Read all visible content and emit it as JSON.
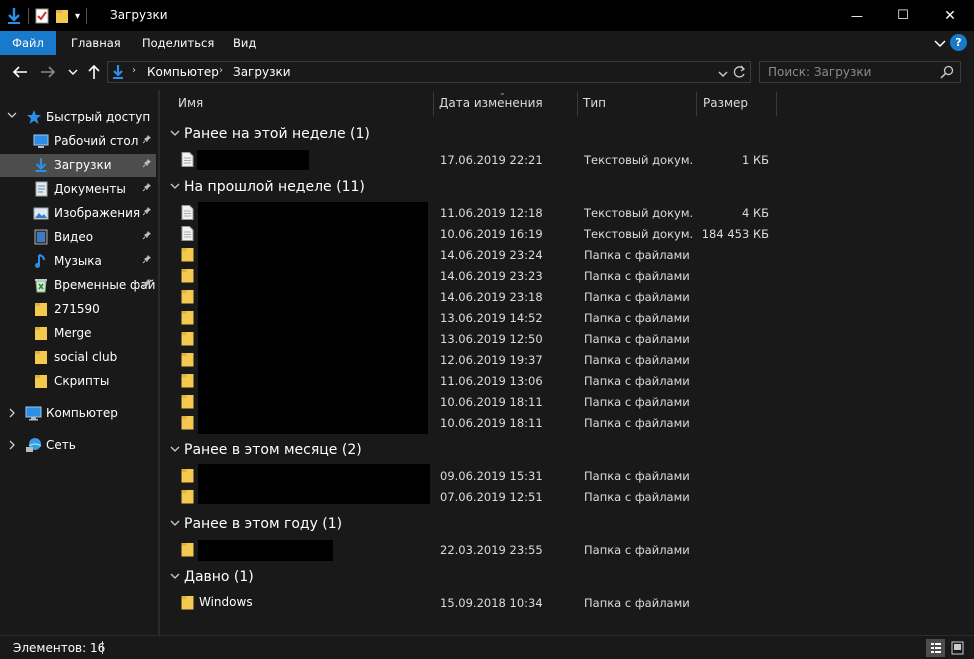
{
  "window": {
    "title": "Загрузки",
    "minimize_glyph": "—",
    "maximize_glyph": "☐",
    "close_glyph": "✕"
  },
  "ribbon": {
    "tabs": [
      "Файл",
      "Главная",
      "Поделиться",
      "Вид"
    ],
    "help_glyph": "?"
  },
  "address": {
    "crumbs": [
      "Компьютер",
      "Загрузки"
    ],
    "search_placeholder": "Поиск: Загрузки"
  },
  "sidebar": {
    "quick_access": "Быстрый доступ",
    "items": [
      {
        "label": "Рабочий стол",
        "icon": "desktop-icon",
        "pinned": true
      },
      {
        "label": "Загрузки",
        "icon": "download-icon",
        "pinned": true,
        "active": true
      },
      {
        "label": "Документы",
        "icon": "documents-icon",
        "pinned": true
      },
      {
        "label": "Изображения",
        "icon": "pictures-icon",
        "pinned": true
      },
      {
        "label": "Видео",
        "icon": "video-icon",
        "pinned": true
      },
      {
        "label": "Музыка",
        "icon": "music-icon",
        "pinned": true
      },
      {
        "label": "Временные фай",
        "icon": "recycle-icon",
        "pinned": true
      },
      {
        "label": "271590",
        "icon": "folder-icon",
        "pinned": false
      },
      {
        "label": "Merge",
        "icon": "folder-icon",
        "pinned": false
      },
      {
        "label": "social club",
        "icon": "folder-icon",
        "pinned": false
      },
      {
        "label": "Скрипты",
        "icon": "folder-icon",
        "pinned": false
      }
    ],
    "computer": "Компьютер",
    "network": "Сеть"
  },
  "columns": {
    "name": "Имя",
    "date": "Дата изменения",
    "type": "Тип",
    "size": "Размер"
  },
  "groups": [
    {
      "title": "Ранее на этой неделе (1)",
      "rows": [
        {
          "name": "",
          "date": "17.06.2019 22:21",
          "type": "Текстовый докум...",
          "size": "1 КБ",
          "icon": "file"
        }
      ]
    },
    {
      "title": "На прошлой неделе (11)",
      "rows": [
        {
          "name": "",
          "date": "11.06.2019 12:18",
          "type": "Текстовый докум...",
          "size": "4 КБ",
          "icon": "file"
        },
        {
          "name": "",
          "date": "10.06.2019 16:19",
          "type": "Текстовый докум...",
          "size": "184 453 КБ",
          "icon": "file"
        },
        {
          "name": "",
          "date": "14.06.2019 23:24",
          "type": "Папка с файлами",
          "size": "",
          "icon": "folder"
        },
        {
          "name": "",
          "date": "14.06.2019 23:23",
          "type": "Папка с файлами",
          "size": "",
          "icon": "folder"
        },
        {
          "name": "",
          "date": "14.06.2019 23:18",
          "type": "Папка с файлами",
          "size": "",
          "icon": "folder"
        },
        {
          "name": "",
          "date": "13.06.2019 14:52",
          "type": "Папка с файлами",
          "size": "",
          "icon": "folder"
        },
        {
          "name": "",
          "date": "13.06.2019 12:50",
          "type": "Папка с файлами",
          "size": "",
          "icon": "folder"
        },
        {
          "name": "",
          "date": "12.06.2019 19:37",
          "type": "Папка с файлами",
          "size": "",
          "icon": "folder"
        },
        {
          "name": "",
          "date": "11.06.2019 13:06",
          "type": "Папка с файлами",
          "size": "",
          "icon": "folder"
        },
        {
          "name": "",
          "date": "10.06.2019 18:11",
          "type": "Папка с файлами",
          "size": "",
          "icon": "folder"
        },
        {
          "name": "",
          "date": "10.06.2019 18:11",
          "type": "Папка с файлами",
          "size": "",
          "icon": "folder"
        }
      ]
    },
    {
      "title": "Ранее в этом месяце (2)",
      "rows": [
        {
          "name": "",
          "date": "09.06.2019 15:31",
          "type": "Папка с файлами",
          "size": "",
          "icon": "folder"
        },
        {
          "name": "",
          "date": "07.06.2019 12:51",
          "type": "Папка с файлами",
          "size": "",
          "icon": "folder"
        }
      ]
    },
    {
      "title": "Ранее в этом году (1)",
      "rows": [
        {
          "name": "",
          "date": "22.03.2019 23:55",
          "type": "Папка с файлами",
          "size": "",
          "icon": "folder"
        }
      ]
    },
    {
      "title": "Давно (1)",
      "rows": [
        {
          "name": "Windows",
          "date": "15.09.2018 10:34",
          "type": "Папка с файлами",
          "size": "",
          "icon": "folder"
        }
      ]
    }
  ],
  "status": {
    "count": "Элементов: 16"
  },
  "colors": {
    "accent": "#1979ca",
    "folder": "#f3c94f",
    "background": "#191919"
  }
}
